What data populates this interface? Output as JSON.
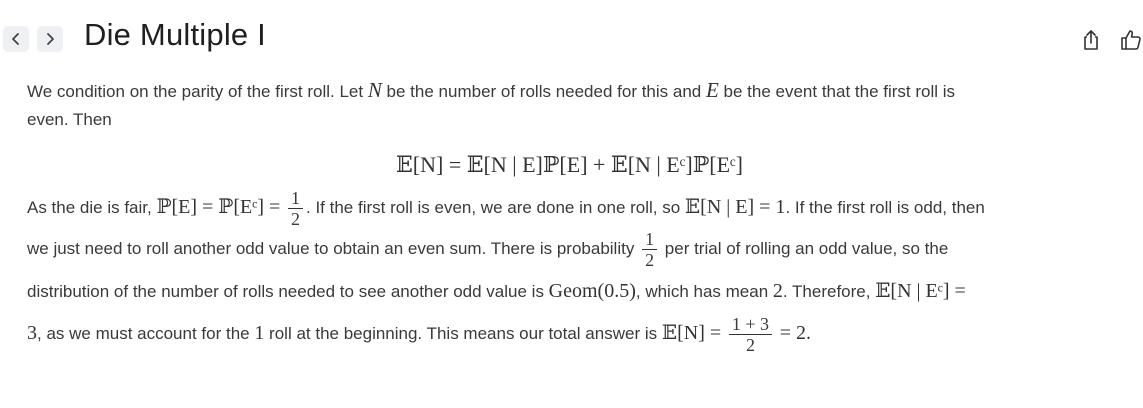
{
  "header": {
    "title": "Die Multiple I",
    "back_icon": "chevron-left-icon",
    "forward_icon": "chevron-right-icon",
    "share_icon": "share-icon",
    "like_icon": "thumbs-up-icon"
  },
  "content": {
    "p1_a": "We condition on the parity of the first roll. Let ",
    "p1_N": "N",
    "p1_b": " be the number of rolls needed for this and ",
    "p1_E": "E",
    "p1_c": " be the event that the first roll is",
    "p1_d": "even. Then",
    "display_eq": "𝔼[N] = 𝔼[N | E]ℙ[E] + 𝔼[N | Eᶜ]ℙ[Eᶜ]",
    "p2_a": "As the die is fair, ",
    "p2_eq1": "ℙ[E] = ℙ[Eᶜ] =",
    "frac_half_num": "1",
    "frac_half_den": "2",
    "p2_b": ". If the first roll is even, we are done in one roll, so ",
    "p2_eq2": "𝔼[N | E] = 1",
    "p2_c": ". If the first roll is odd, then",
    "p3_a": "we just need to roll another odd value to obtain an even sum. There is probability ",
    "p3_b": " per trial of rolling an odd value, so the",
    "p4_a": "distribution of the number of rolls needed to see another odd value is ",
    "p4_geom": "Geom(0.5)",
    "p4_b": ", which has mean ",
    "p4_two": "2",
    "p4_c": ". Therefore, ",
    "p4_eq": "𝔼[N | Eᶜ] =",
    "p5_three": "3",
    "p5_a": ", as we must account for the ",
    "p5_one": "1",
    "p5_b": " roll at the beginning. This means our total answer is ",
    "p5_eq": "𝔼[N] =",
    "frac_total_num": "1 + 3",
    "frac_total_den": "2",
    "p5_end": "= 2."
  },
  "colors": {
    "background": "#ffffff",
    "title": "#1f1f1f",
    "text": "#3a3a3a",
    "nav_button_bg": "#eef0f3"
  }
}
